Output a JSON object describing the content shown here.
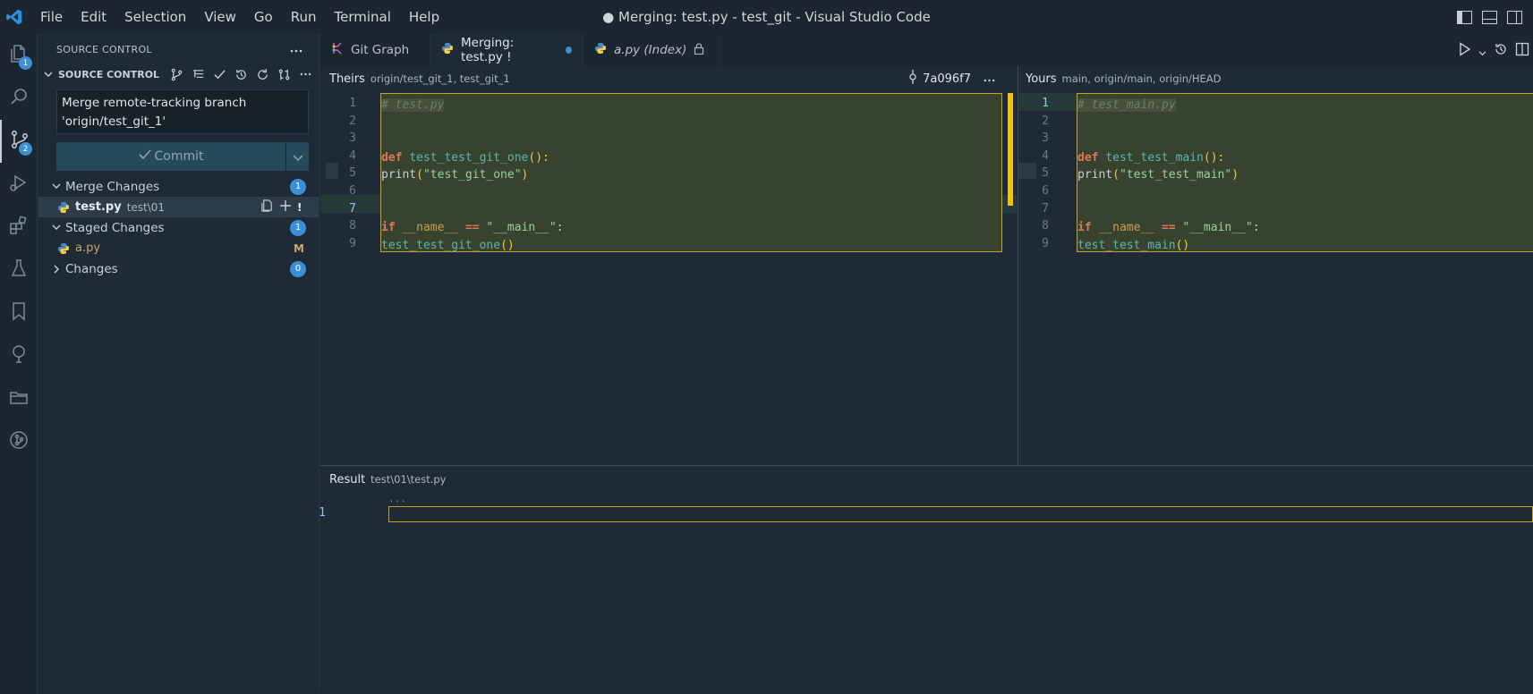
{
  "title_bar": {
    "menu": [
      "File",
      "Edit",
      "Selection",
      "View",
      "Go",
      "Run",
      "Terminal",
      "Help"
    ],
    "window_title": "● Merging: test.py - test_git - Visual Studio Code"
  },
  "activity_bar": {
    "explorer_badge": "1",
    "scm_badge": "2"
  },
  "sidebar": {
    "header": "SOURCE CONTROL",
    "section_title": "SOURCE CONTROL",
    "commit_message_line1": "Merge remote-tracking branch",
    "commit_message_line2": "'origin/test_git_1'",
    "commit_label": "Commit",
    "merge_changes": {
      "label": "Merge Changes",
      "count": "1"
    },
    "merge_file": {
      "name": "test.py",
      "path": "test\\01",
      "status": "!"
    },
    "staged_changes": {
      "label": "Staged Changes",
      "count": "1"
    },
    "staged_file": {
      "name": "a.py",
      "status": "M"
    },
    "changes": {
      "label": "Changes",
      "count": "0"
    }
  },
  "tabs": [
    {
      "label": "Git Graph"
    },
    {
      "label": "Merging: test.py",
      "mark": "!"
    },
    {
      "label": "a.py (Index)"
    }
  ],
  "theirs": {
    "label": "Theirs",
    "refs": "origin/test_git_1, test_git_1",
    "hash": "7a096f7",
    "line_numbers": [
      "1",
      "2",
      "3",
      "4",
      "5",
      "6",
      "7",
      "8",
      "9"
    ]
  },
  "yours": {
    "label": "Yours",
    "refs": "main, origin/main, origin/HEAD",
    "line_numbers": [
      "1",
      "2",
      "3",
      "4",
      "5",
      "6",
      "7",
      "8",
      "9"
    ]
  },
  "result": {
    "label": "Result",
    "path": "test\\01\\test.py",
    "ellipsis": "...",
    "line_number": "1"
  },
  "colors": {
    "accent": "#3a8fd6",
    "conflict_border": "#c8a12a",
    "keyword": "#e0775b",
    "function": "#5fb3a8",
    "string": "#9ad0a0"
  }
}
